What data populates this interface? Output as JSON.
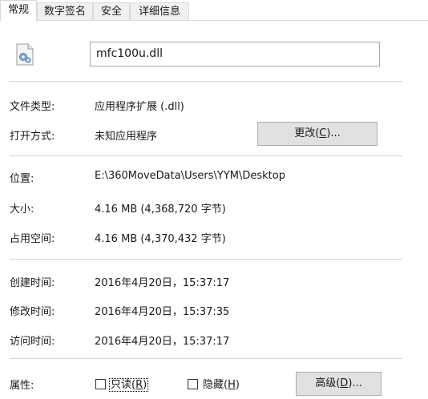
{
  "tabs": [
    {
      "label": "常规",
      "active": true
    },
    {
      "label": "数字签名",
      "active": false
    },
    {
      "label": "安全",
      "active": false
    },
    {
      "label": "详细信息",
      "active": false
    }
  ],
  "file": {
    "icon": "dll-file-gear-icon",
    "name": "mfc100u.dll"
  },
  "rows": {
    "type": {
      "label": "文件类型:",
      "value": "应用程序扩展 (.dll)"
    },
    "opens_with": {
      "label": "打开方式:",
      "value": "未知应用程序"
    },
    "location": {
      "label": "位置:",
      "value": "E:\\360MoveData\\Users\\YYM\\Desktop"
    },
    "size": {
      "label": "大小:",
      "value": "4.16 MB (4,368,720 字节)"
    },
    "size_on_disk": {
      "label": "占用空间:",
      "value": "4.16 MB (4,370,432 字节)"
    },
    "created": {
      "label": "创建时间:",
      "value": "2016年4月20日，15:37:17"
    },
    "modified": {
      "label": "修改时间:",
      "value": "2016年4月20日，15:37:35"
    },
    "accessed": {
      "label": "访问时间:",
      "value": "2016年4月20日，15:37:17"
    }
  },
  "change_button": {
    "text": "更改(",
    "key": "C",
    "suffix": ")..."
  },
  "attributes": {
    "label": "属性:",
    "readonly": {
      "text": "只读(",
      "key": "R",
      "suffix": ")",
      "checked": false
    },
    "hidden": {
      "text": "隐藏(",
      "key": "H",
      "suffix": ")",
      "checked": false
    },
    "advanced": {
      "text": "高级(",
      "key": "D",
      "suffix": ")..."
    }
  }
}
